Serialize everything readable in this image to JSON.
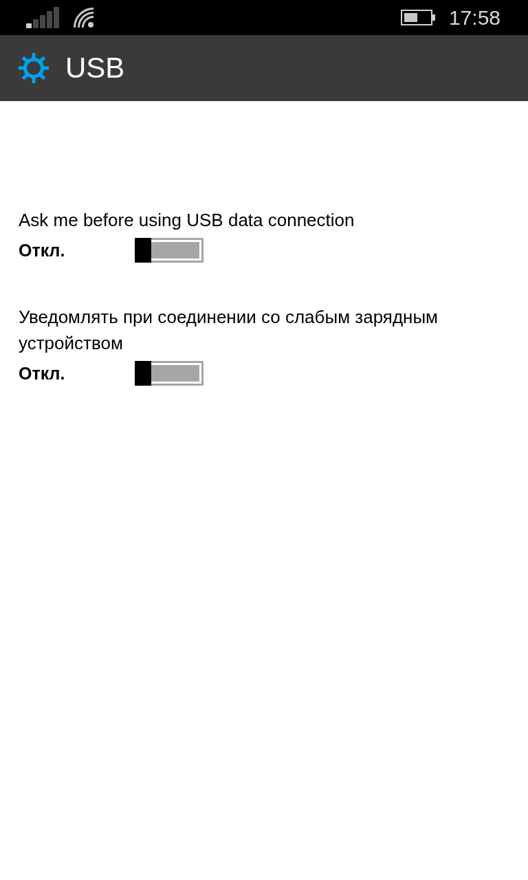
{
  "status_bar": {
    "time": "17:58"
  },
  "header": {
    "title": "USB"
  },
  "settings": [
    {
      "label": "Ask me before using USB data connection",
      "state_text": "Откл.",
      "on": false
    },
    {
      "label": "Уведомлять при соединении со слабым зарядным устройством",
      "state_text": "Откл.",
      "on": false
    }
  ]
}
